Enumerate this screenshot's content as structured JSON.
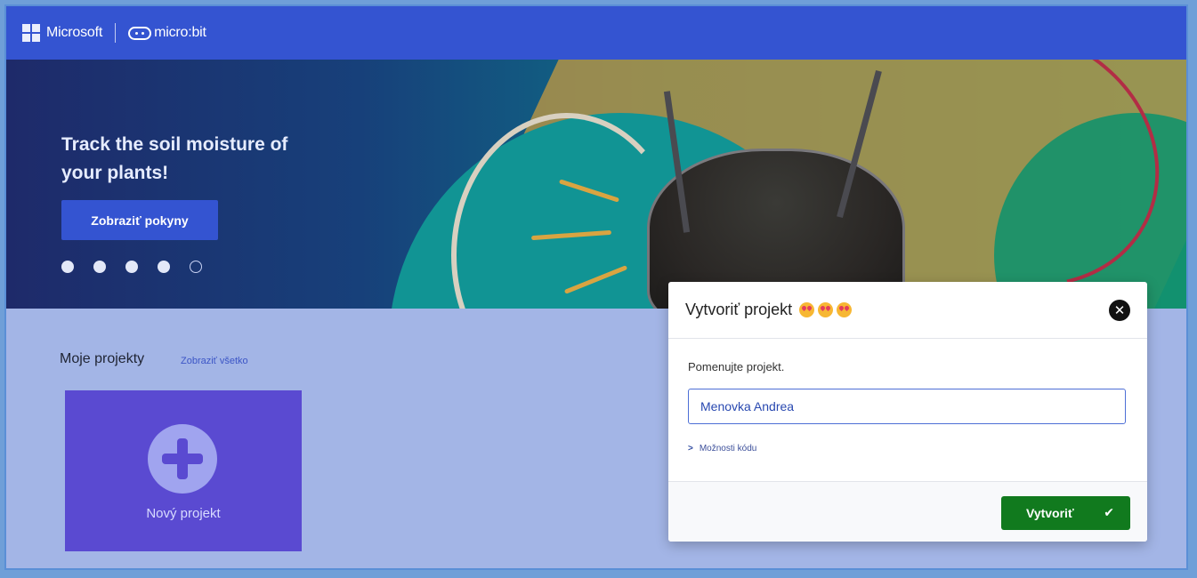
{
  "topbar": {
    "microsoft_label": "Microsoft",
    "product_label": "micro:bit"
  },
  "hero": {
    "title": "Track the soil moisture of your plants!",
    "button_label": "Zobraziť pokyny",
    "carousel": {
      "total": 5,
      "active_index": 4
    }
  },
  "projects": {
    "title": "Moje projekty",
    "view_all_label": "Zobraziť všetko",
    "new_project_label": "Nový projekt"
  },
  "dialog": {
    "title": "Vytvoriť projekt",
    "emoji_icons": [
      "heart-eyes-emoji",
      "heart-eyes-emoji",
      "heart-eyes-emoji"
    ],
    "prompt": "Pomenujte projekt.",
    "input_value": "Menovka Andrea",
    "code_options_label": "Možnosti kódu",
    "create_label": "Vytvoriť"
  },
  "colors": {
    "topbar": "#3454d1",
    "page_overlay": "#a3b5e6",
    "new_project_tile": "#5a4ad1",
    "create_button": "#117a1e",
    "input_border": "#4d6fd6"
  }
}
